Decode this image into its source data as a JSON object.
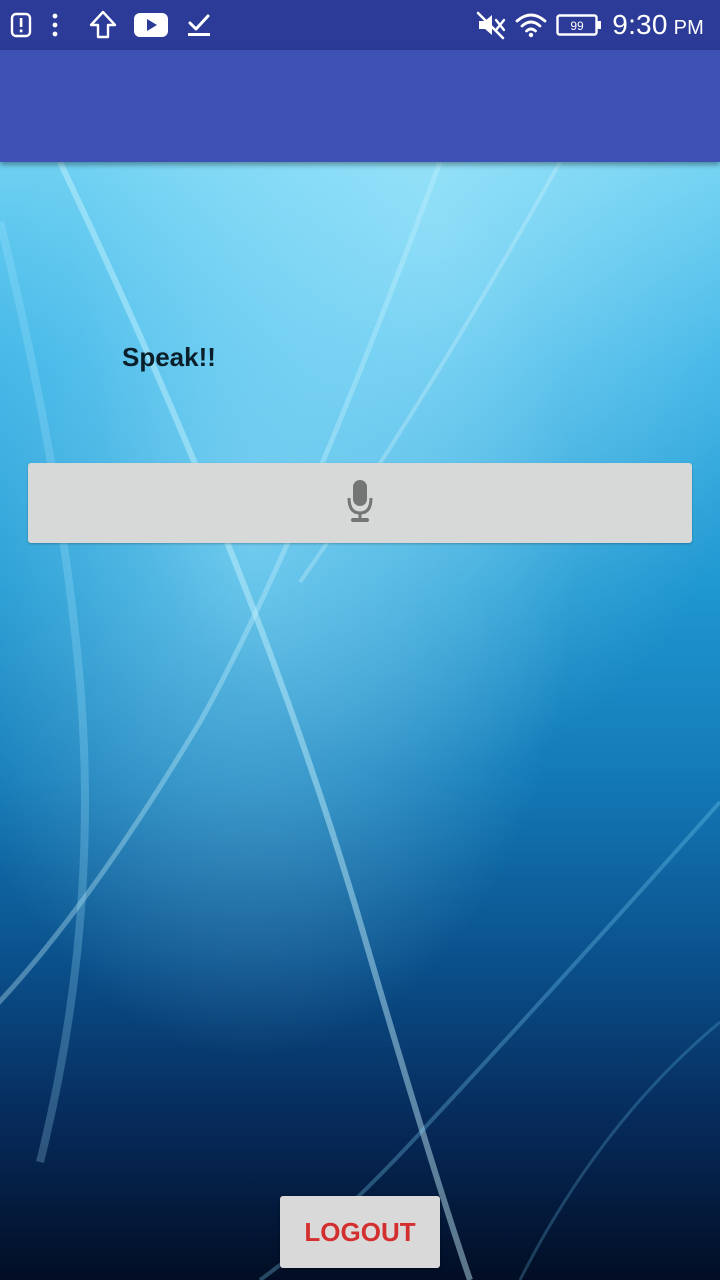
{
  "status_bar": {
    "time": "9:30",
    "ampm": "PM",
    "battery_level": "99",
    "left_icons": [
      "alert-icon",
      "more-vert-icon",
      "upload-arrow-icon",
      "youtube-icon",
      "download-done-icon"
    ],
    "right_icons": [
      "mute-icon",
      "wifi-icon",
      "battery-icon"
    ]
  },
  "app_bar": {
    "title": ""
  },
  "main": {
    "speak_label": "Speak!!",
    "mic_button_icon": "microphone-icon",
    "logout_label": "LOGOUT"
  },
  "colors": {
    "status_bar": "#2c3b97",
    "app_bar": "#3e51b5",
    "button_bg": "#d7d8d8",
    "logout_text": "#d32f2f",
    "speak_text": "#0b1f2a"
  }
}
